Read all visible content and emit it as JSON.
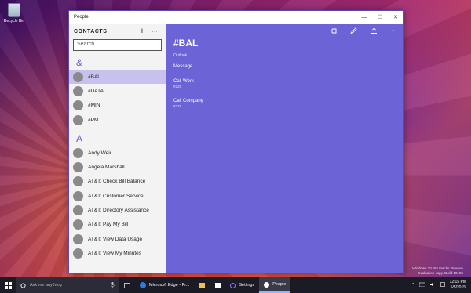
{
  "desktop": {
    "recycle_bin_label": "Recycle Bin",
    "watermark_line1": "Windows 10 Pro Insider Preview",
    "watermark_line2": "Evaluation copy. Build 10105"
  },
  "window": {
    "title": "People",
    "controls": {
      "minimize": "—",
      "maximize": "☐",
      "close": "✕"
    }
  },
  "contacts": {
    "header": "CONTACTS",
    "add_icon": "+",
    "more_icon": "···",
    "search_placeholder": "Search",
    "groups": [
      {
        "letter": "&",
        "items": [
          "#BAL",
          "#DATA",
          "#MIN",
          "#PMT"
        ]
      },
      {
        "letter": "A",
        "items": [
          "Andy Weir",
          "Angela Marshall",
          "AT&T: Check Bill Balance",
          "AT&T: Customer Service",
          "AT&T: Directory Assistance",
          "AT&T: Pay My Bill",
          "AT&T: View Data Usage",
          "AT&T: View My Minutes"
        ]
      }
    ]
  },
  "detail": {
    "name": "#BAL",
    "source": "Outlook",
    "message_label": "Message",
    "fields": [
      {
        "label": "Call Work",
        "value": "#225"
      },
      {
        "label": "Call Company",
        "value": "#225"
      }
    ],
    "toolbar": [
      "pin-icon",
      "edit-icon",
      "share-icon",
      "more-icon"
    ],
    "more_glyph": "···"
  },
  "taskbar": {
    "search_text": "Ask me anything",
    "apps": [
      {
        "label": "Microsoft Edge - Pr...",
        "icon": "edge-icon"
      },
      {
        "label": "",
        "icon": "explorer-icon"
      },
      {
        "label": "",
        "icon": "store-icon"
      },
      {
        "label": "Settings",
        "icon": "settings-icon"
      },
      {
        "label": "People",
        "icon": "people-icon",
        "active": true
      }
    ],
    "time": "12:15 PM",
    "date": "5/5/2015"
  },
  "colors": {
    "accent": "#6c63d6",
    "selected_row": "#c7c1ee",
    "taskbar": "#1b1b26"
  }
}
